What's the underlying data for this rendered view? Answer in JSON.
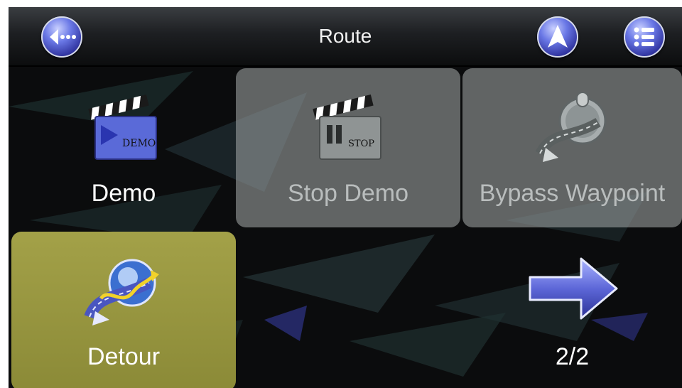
{
  "header": {
    "title": "Route"
  },
  "tiles": {
    "demo": {
      "label": "Demo",
      "state": "enabled"
    },
    "stop_demo": {
      "label": "Stop Demo",
      "state": "disabled"
    },
    "bypass_waypoint": {
      "label": "Bypass Waypoint",
      "state": "disabled"
    },
    "detour": {
      "label": "Detour",
      "state": "selected"
    }
  },
  "pager": {
    "label": "2/2",
    "icon": "arrow-right-icon"
  },
  "icons": {
    "back": "back-icon",
    "navigate": "navigation-arrow-icon",
    "menu": "list-menu-icon"
  },
  "colors": {
    "header_text": "#f2f2f2",
    "button_blue": "#3a3fb8",
    "tile_disabled": "#969b9b",
    "tile_selected": "#9a9842",
    "label_disabled": "#b9bdbd"
  }
}
